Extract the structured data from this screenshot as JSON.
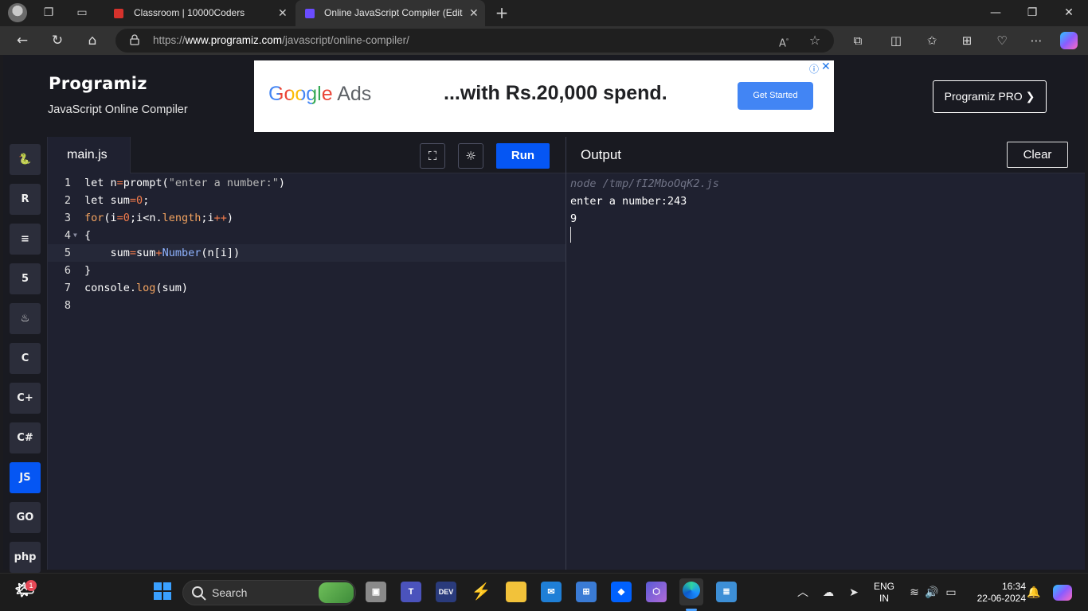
{
  "browser": {
    "tabs": [
      {
        "label": "Classroom | 10000Coders",
        "favicon_color": "#d6322c"
      },
      {
        "label": "Online JavaScript Compiler (Edito",
        "favicon_color": "#6a4cff",
        "active": true
      }
    ],
    "url_prefix": "https://",
    "url_host": "www.programiz.com",
    "url_path": "/javascript/online-compiler/",
    "icons": [
      "back-icon",
      "refresh-icon",
      "home-icon",
      "lock-icon",
      "read-aloud-icon",
      "favorite-star-icon",
      "extensions-icon",
      "split-screen-icon",
      "favorites-icon",
      "collections-icon",
      "browser-essentials-icon",
      "more-icon",
      "copilot-icon"
    ]
  },
  "header": {
    "logo": "Programiz",
    "subtitle": "JavaScript Online Compiler",
    "pro_button": "Programiz PRO ❯"
  },
  "ad": {
    "brand_google": "Google",
    "brand_ads": "Ads",
    "tagline": "...with Rs.20,000 spend.",
    "cta": "Get Started",
    "info": "ⓘ",
    "close": "✕"
  },
  "languages": [
    {
      "name": "python-lang",
      "label": "🐍",
      "active": false
    },
    {
      "name": "r-lang",
      "label": "R",
      "active": false
    },
    {
      "name": "sql-lang",
      "label": "≡",
      "active": false
    },
    {
      "name": "html-lang",
      "label": "5",
      "active": false
    },
    {
      "name": "java-lang",
      "label": "♨",
      "active": false
    },
    {
      "name": "c-lang",
      "label": "C",
      "active": false
    },
    {
      "name": "cpp-lang",
      "label": "C+",
      "active": false
    },
    {
      "name": "csharp-lang",
      "label": "C#",
      "active": false
    },
    {
      "name": "js-lang",
      "label": "JS",
      "active": true
    },
    {
      "name": "go-lang",
      "label": "GO",
      "active": false
    },
    {
      "name": "php-lang",
      "label": "php",
      "active": false
    }
  ],
  "editor": {
    "file_tab": "main.js",
    "run_label": "Run",
    "line_numbers": [
      "1",
      "2",
      "3",
      "4",
      "5",
      "6",
      "7",
      "8"
    ],
    "lines": [
      "let n=prompt(\"enter a number:\")",
      "let sum=0;",
      "for(i=0;i<n.length;i++)",
      "{",
      "    sum=sum+Number(n[i])",
      "}",
      "console.log(sum)",
      ""
    ]
  },
  "output": {
    "title": "Output",
    "clear_label": "Clear",
    "lines": [
      "node /tmp/fI2MboOqK2.js",
      "enter a number:243",
      "9"
    ]
  },
  "taskbar": {
    "search_placeholder": "Search",
    "notification_count": "1",
    "lang_top": "ENG",
    "lang_bottom": "IN",
    "time": "16:34",
    "date": "22-06-2024"
  }
}
